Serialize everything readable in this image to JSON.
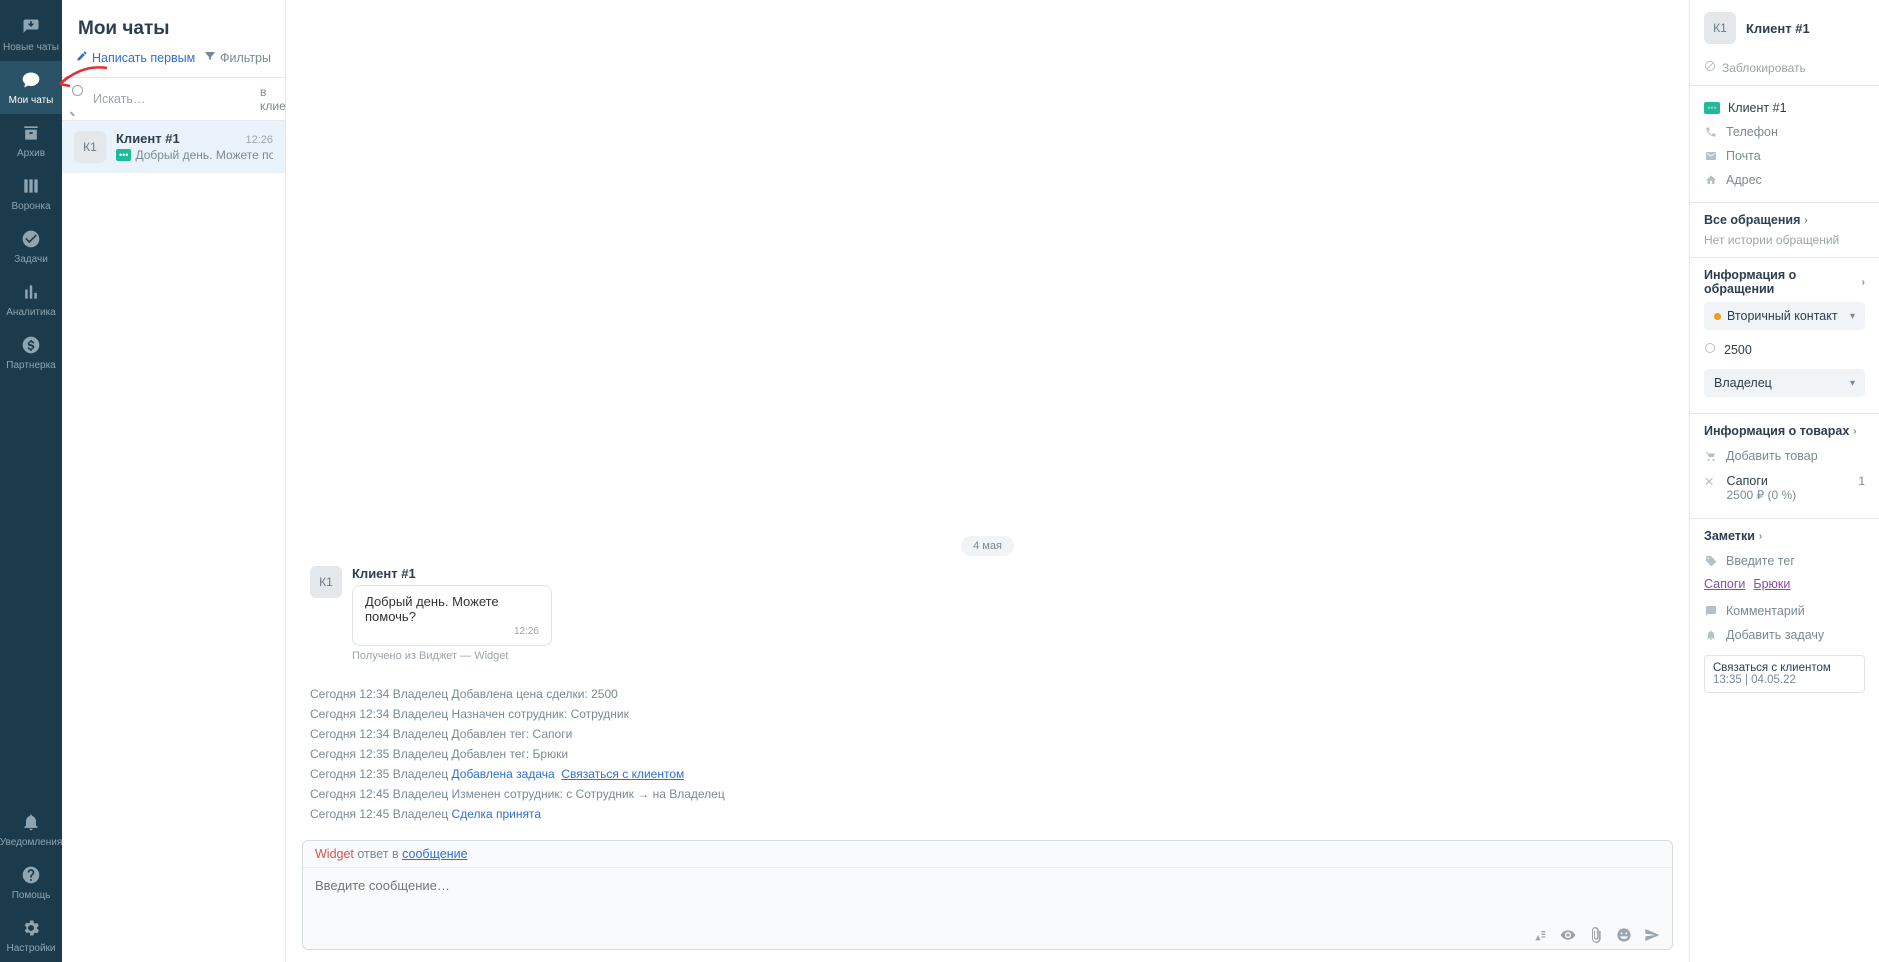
{
  "nav": {
    "items": [
      {
        "label": "Новые чаты",
        "name": "nav-new-chats"
      },
      {
        "label": "Мои чаты",
        "name": "nav-my-chats"
      },
      {
        "label": "Архив",
        "name": "nav-archive"
      },
      {
        "label": "Воронка",
        "name": "nav-funnel"
      },
      {
        "label": "Задачи",
        "name": "nav-tasks"
      },
      {
        "label": "Аналитика",
        "name": "nav-analytics"
      },
      {
        "label": "Партнерка",
        "name": "nav-partner"
      }
    ],
    "bottom": [
      {
        "label": "Уведомления",
        "name": "nav-notifications"
      },
      {
        "label": "Помощь",
        "name": "nav-help"
      },
      {
        "label": "Настройки",
        "name": "nav-settings"
      }
    ]
  },
  "chat_list": {
    "title": "Мои чаты",
    "write_first": "Написать первым",
    "filters": "Фильтры",
    "search_placeholder": "Искать…",
    "scope": "в клиентах",
    "items": [
      {
        "avatar": "К1",
        "name": "Клиент #1",
        "time": "12:26",
        "preview": "Добрый день. Можете пом…"
      }
    ]
  },
  "conversation": {
    "date": "4 мая",
    "sender_avatar": "К1",
    "sender_name": "Клиент #1",
    "message_text": "Добрый день. Можете помочь?",
    "message_time": "12:26",
    "source": "Получено из Виджет — Widget",
    "logs": [
      "Сегодня 12:34  Владелец  Добавлена цена сделки:  2500",
      "Сегодня 12:34  Владелец  Назначен сотрудник:  Сотрудник",
      "Сегодня 12:34  Владелец  Добавлен тег:  Сапоги",
      "Сегодня 12:35  Владелец  Добавлен тег:  Брюки"
    ],
    "log5_prefix": "Сегодня 12:35  Владелец  ",
    "log5_link1": "Добавлена задача",
    "log5_link2": "Связаться с клиентом",
    "log6": "Сегодня 12:45  Владелец  Изменен сотрудник: с  Сотрудник   →   на  Владелец",
    "log7_prefix": "Сегодня 12:45  Владелец  ",
    "log7_link": "Сделка принята"
  },
  "composer": {
    "tab_widget": "Widget",
    "tab_mid": " ответ в ",
    "tab_link": "сообщение",
    "placeholder": "Введите сообщение…"
  },
  "details": {
    "avatar": "К1",
    "name": "Клиент #1",
    "block": "Заблокировать",
    "contact_name": "Клиент #1",
    "phone_label": "Телефон",
    "email_label": "Почта",
    "address_label": "Адрес",
    "requests_heading": "Все обращения",
    "requests_empty": "Нет истории обращений",
    "info_heading": "Информация о обращении",
    "status": "Вторичный контакт",
    "amount": "2500",
    "owner": "Владелец",
    "products_heading": "Информация о товарах",
    "add_product": "Добавить товар",
    "product": {
      "name": "Сапоги",
      "price": "2500 ₽",
      "discount": "(0 %)",
      "qty": "1"
    },
    "notes_heading": "Заметки",
    "tag_placeholder": "Введите тег",
    "tags": [
      "Сапоги",
      "Брюки"
    ],
    "comment_placeholder": "Комментарий",
    "add_task": "Добавить задачу",
    "task": {
      "title": "Связаться с клиентом",
      "meta": "13:35 | 04.05.22"
    }
  }
}
